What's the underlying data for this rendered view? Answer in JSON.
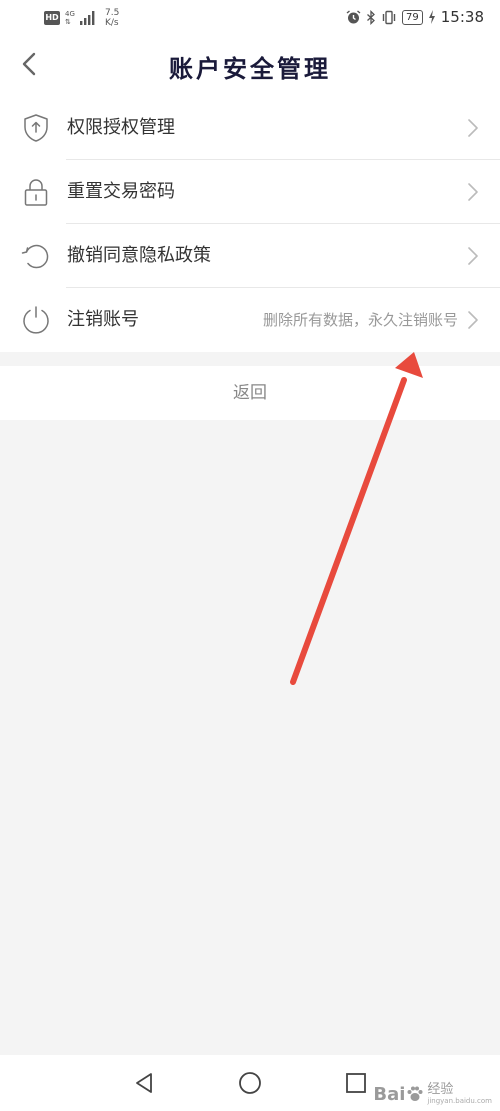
{
  "status_bar": {
    "hd": "HD",
    "network_top": "4G",
    "network_bottom": "⇅",
    "speed": "7.5\nK/s",
    "battery": "79",
    "time": "15:38",
    "icons": [
      "signal-icon",
      "alarm-icon",
      "bluetooth-icon",
      "vibrate-icon",
      "battery-icon",
      "charging-icon"
    ]
  },
  "header": {
    "title": "账户安全管理",
    "back_icon": "chevron-left-icon"
  },
  "menu": {
    "items": [
      {
        "label": "权限授权管理",
        "icon": "shield-icon",
        "hint": ""
      },
      {
        "label": "重置交易密码",
        "icon": "lock-icon",
        "hint": ""
      },
      {
        "label": "撤销同意隐私政策",
        "icon": "revoke-icon",
        "hint": ""
      },
      {
        "label": "注销账号",
        "icon": "power-icon",
        "hint": "删除所有数据，永久注销账号"
      }
    ]
  },
  "return_label": "返回",
  "nav_bar": {
    "icons": [
      "back-triangle-icon",
      "home-circle-icon",
      "recents-square-icon"
    ]
  },
  "watermark": {
    "brand": "Bai",
    "brand2": "经验",
    "url": "jingyan.baidu.com"
  },
  "colors": {
    "annotation_arrow": "#e84a3d",
    "title": "#1a1a3a",
    "page_background": "#f4f4f4"
  }
}
